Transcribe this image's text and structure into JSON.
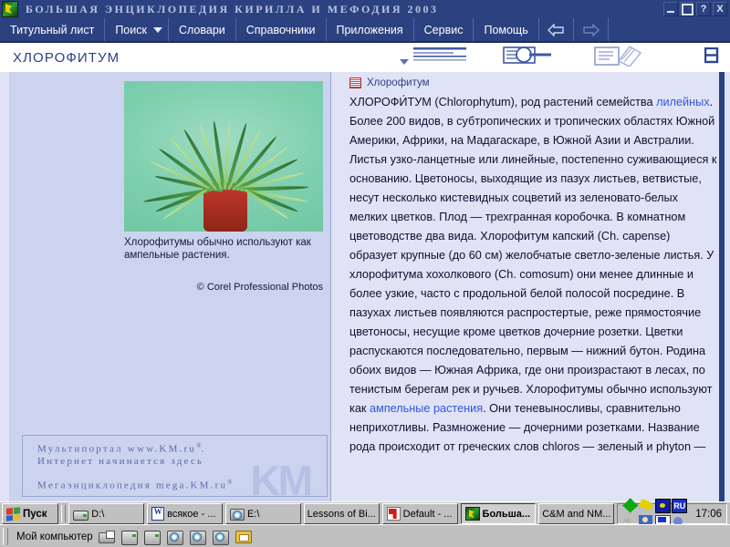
{
  "window": {
    "title": "БОЛЬШАЯ ЭНЦИКЛОПЕДИЯ КИРИЛЛА И МЕФОДИЯ 2003",
    "app_icon": "encyclopedia-icon",
    "controls": {
      "minimize": "_",
      "maximize": "□",
      "help": "?",
      "close": "X"
    }
  },
  "menu": {
    "items": [
      {
        "label": "Титульный лист",
        "accel": "Т",
        "icon": ""
      },
      {
        "label": "Поиск",
        "accel": "П",
        "icon": "chevron-down-icon"
      },
      {
        "label": "Словари",
        "accel": "С",
        "icon": ""
      },
      {
        "label": "Справочники",
        "accel": "",
        "icon": ""
      },
      {
        "label": "Приложения",
        "accel": "л",
        "icon": ""
      },
      {
        "label": "Сервис",
        "accel": "е",
        "icon": ""
      },
      {
        "label": "Помощь",
        "accel": "о",
        "icon": ""
      }
    ],
    "nav": {
      "back": "back-arrow-icon",
      "forward": "forward-arrow-icon"
    }
  },
  "header": {
    "article_title": "ХЛОРОФИТУМ",
    "tools": [
      {
        "name": "article-list-icon"
      },
      {
        "name": "search-in-article-icon"
      },
      {
        "name": "copy-article-icon"
      },
      {
        "name": "split-view-icon"
      }
    ]
  },
  "left_pane": {
    "figure": {
      "image_alt": "Хлорофитум — комнатное растение в красном горшке",
      "caption": "Хлорофитумы обычно используют как ампельные растения.",
      "copyright": "© Corel Professional Photos"
    },
    "ad": {
      "line1": "Мультипортал www.KM.ru",
      "line1_sup": "®",
      "line1_end": ".",
      "line2": "Интернет начинается здесь",
      "line3": "Мегаэнциклопедия mega.KM.ru",
      "line3_sup": "®",
      "watermark": "KM"
    }
  },
  "right_pane": {
    "reference": {
      "icon": "image-thumbnail-icon",
      "label": "Хлорофитум"
    },
    "body": {
      "p1_a": "ХЛОРОФИ́ТУМ (Chlorophytum), род растений семейства ",
      "link1": "лилейных",
      "p1_b": ". Более 200 видов, в субтропических и тропических областях Южной Америки, Африки, на Мадагаскаре, в Южной Азии и Австралии. Листья узко-ланцетные или линейные, постепенно суживающиеся к основанию. Цветоносы, выходящие из пазух листьев, ветвистые, несут несколько кистевидных соцветий из зеленовато-белых мелких цветков. Плод — трехгранная коробочка. В комнатном цветоводстве два вида. Хлорофитум капский (Ch. capense) образует крупные (до 60 см) желобчатые светло-зеленые листья. У хлорофитума хохолкового (Ch. comosum) они менее длинные и более узкие, часто с продольной белой полосой посредине. В пазухах листьев появляются распростертые, реже прямостоячие цветоносы, несущие кроме цветков дочерние розетки. Цветки распускаются последовательно, первым — нижний бутон. Родина обоих видов — Южная Африка, где они произрастают в лесах, по тенистым берегам рек и ручьев. Хлорофитумы обычно используют как ",
      "link2": "ампельные растения",
      "p1_c": ". Они теневыносливы, сравнительно неприхотливы. Размножение — дочерними розетками. Название рода происходит от греческих слов chloros — зеленый и phyton — "
    }
  },
  "taskbar": {
    "start": {
      "label": "Пуск",
      "icon": "windows-logo-icon"
    },
    "buttons": [
      {
        "label": "D:\\",
        "icon": "drive-icon",
        "active": false
      },
      {
        "label": "всякое - ...",
        "icon": "word-document-icon",
        "active": false
      },
      {
        "label": "E:\\",
        "icon": "cd-drive-icon",
        "active": false
      },
      {
        "label": "Lessons of Bi...",
        "icon": "",
        "active": false
      },
      {
        "label": "Default - ...",
        "icon": "realplayer-icon",
        "active": false
      },
      {
        "label": "Больша...",
        "icon": "encyclopedia-icon",
        "active": true
      },
      {
        "label": "C&M and NM...",
        "icon": "",
        "active": false
      }
    ],
    "tray": {
      "icons": [
        "green-diamond-icon",
        "yellow-flash-icon",
        "blue-radar-icon",
        "language-indicator"
      ],
      "icons_row2": [
        "speaker-icon",
        "user-icon",
        "checkmark-icon",
        "network-icon"
      ],
      "language": "RU",
      "clock": "17:06"
    },
    "quicklaunch": {
      "label": "Мой компьютер",
      "icons": [
        "printer-icon",
        "drive-icon",
        "drive-icon",
        "cd-drive-icon",
        "cd-drive-icon",
        "cd-drive-icon",
        "folder-icon"
      ]
    }
  }
}
